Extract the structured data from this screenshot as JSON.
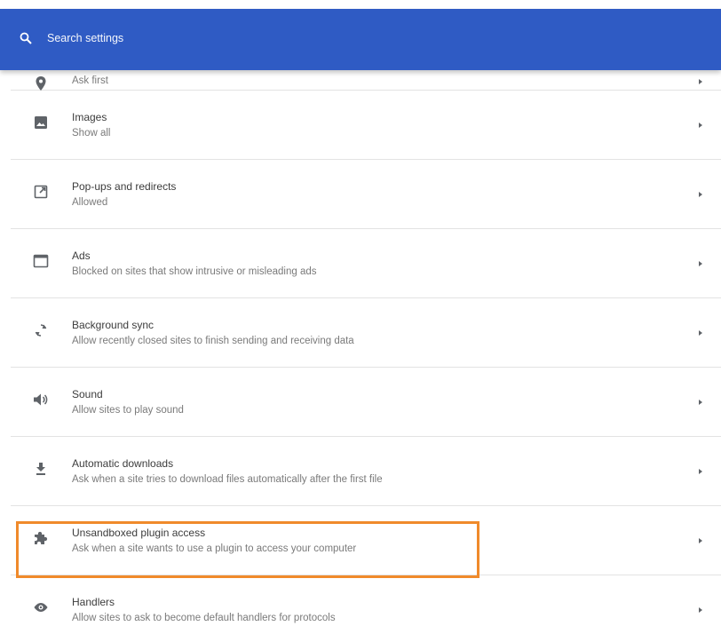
{
  "search": {
    "placeholder": "Search settings",
    "icon": "search-icon"
  },
  "rows": [
    {
      "icon": "location-icon",
      "title": "",
      "subtitle": "Ask first"
    },
    {
      "icon": "image-icon",
      "title": "Images",
      "subtitle": "Show all"
    },
    {
      "icon": "open-in-new-icon",
      "title": "Pop-ups and redirects",
      "subtitle": "Allowed"
    },
    {
      "icon": "browser-window-icon",
      "title": "Ads",
      "subtitle": "Blocked on sites that show intrusive or misleading ads"
    },
    {
      "icon": "sync-icon",
      "title": "Background sync",
      "subtitle": "Allow recently closed sites to finish sending and receiving data"
    },
    {
      "icon": "speaker-icon",
      "title": "Sound",
      "subtitle": "Allow sites to play sound"
    },
    {
      "icon": "download-icon",
      "title": "Automatic downloads",
      "subtitle": "Ask when a site tries to download files automatically after the first file"
    },
    {
      "icon": "puzzle-icon",
      "title": "Unsandboxed plugin access",
      "subtitle": "Ask when a site wants to use a plugin to access your computer"
    },
    {
      "icon": "handlers-icon",
      "title": "Handlers",
      "subtitle": "Allow sites to ask to become default handlers for protocols"
    }
  ],
  "colors": {
    "header": "#2f5bc4",
    "highlight": "#f08a2b",
    "icon": "#5f6368",
    "arrow": "#5f6368"
  }
}
